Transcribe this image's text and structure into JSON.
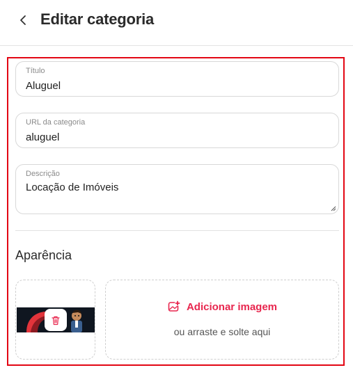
{
  "header": {
    "title": "Editar categoria",
    "back_icon": "chevron-left-icon"
  },
  "form": {
    "title_field": {
      "label": "Título",
      "value": "Aluguel"
    },
    "url_field": {
      "label": "URL da categoria",
      "value": "aluguel"
    },
    "description_field": {
      "label": "Descrição",
      "value": "Locação de Imóveis"
    }
  },
  "appearance": {
    "section_title": "Aparência",
    "delete_icon": "trash-icon",
    "add_image_label": "Adicionar imagem",
    "add_image_icon": "image-plus-icon",
    "drop_hint": "ou arraste e solte aqui"
  },
  "colors": {
    "accent": "#e8264e",
    "highlight_border": "#e30613"
  }
}
